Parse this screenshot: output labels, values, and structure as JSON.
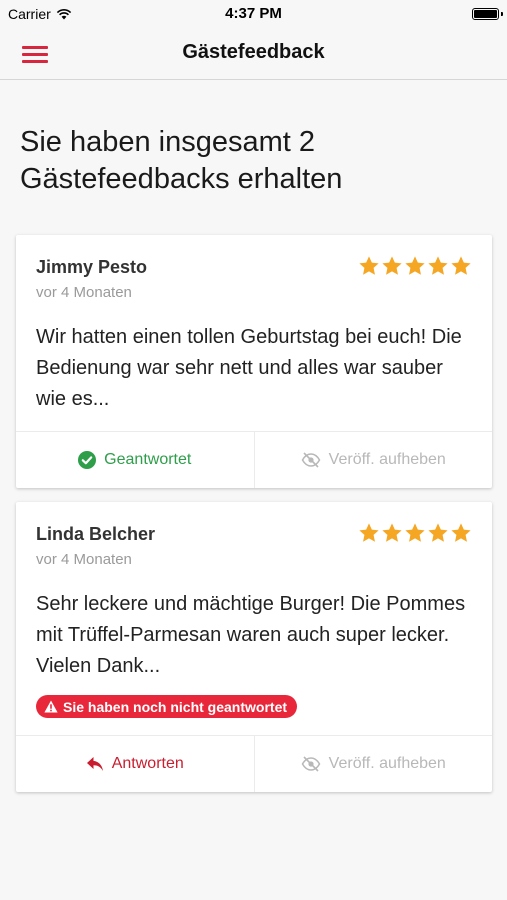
{
  "status_bar": {
    "carrier": "Carrier",
    "time": "4:37 PM"
  },
  "nav": {
    "title": "Gästefeedback",
    "menu_icon": "hamburger-menu-icon"
  },
  "summary": {
    "line1": "Sie haben insgesamt 2",
    "line2": "Gästefeedbacks erhalten"
  },
  "colors": {
    "accent": "#d7263d",
    "star": "#f5a623",
    "answered": "#2e9e4a",
    "disabled": "#b8b8b8",
    "warning": "#e8283a"
  },
  "reviews": [
    {
      "name": "Jimmy Pesto",
      "date": "vor 4 Monaten",
      "rating": 5,
      "text": "Wir hatten einen tollen Geburtstag bei euch! Die Bedienung war sehr nett und alles war sauber wie es...",
      "left_action": {
        "label": "Geantwortet",
        "icon": "check-circle-icon"
      },
      "right_action": {
        "label": "Veröff. aufheben",
        "icon": "eye-slash-icon"
      }
    },
    {
      "name": "Linda Belcher",
      "date": "vor 4 Monaten",
      "rating": 5,
      "text": "Sehr leckere und mächtige Burger! Die Pommes mit Trüffel-Parmesan waren auch super lecker. Vielen Dank...",
      "warning": {
        "label": "Sie haben noch nicht geantwortet",
        "icon": "warning-triangle-icon"
      },
      "left_action": {
        "label": "Antworten",
        "icon": "reply-arrow-icon"
      },
      "right_action": {
        "label": "Veröff. aufheben",
        "icon": "eye-slash-icon"
      }
    }
  ]
}
